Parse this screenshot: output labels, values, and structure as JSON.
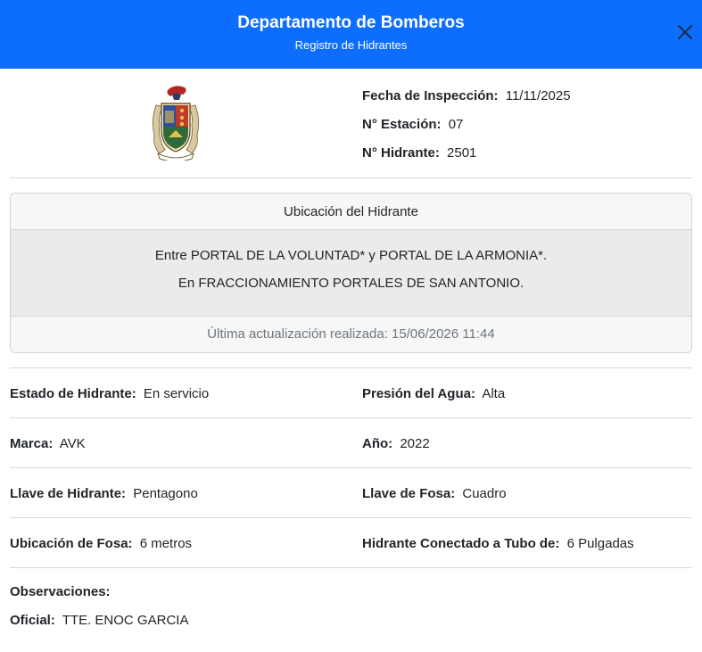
{
  "header": {
    "title": "Departamento de Bomberos",
    "subtitle": "Registro de Hidrantes"
  },
  "icons": {
    "close": "close-icon",
    "emblem": "coat-of-arms-emblem"
  },
  "colors": {
    "header_bg": "#0d6efd",
    "card_body_bg": "#ebebeb",
    "muted_text": "#6c757d"
  },
  "meta": {
    "fecha_label": "Fecha de Inspección:",
    "fecha_value": "11/11/2025",
    "estacion_label": "N° Estación:",
    "estacion_value": "07",
    "hidrante_label": "N° Hidrante:",
    "hidrante_value": "2501"
  },
  "ubicacion": {
    "header": "Ubicación del Hidrante",
    "line1": "Entre PORTAL DE LA VOLUNTAD* y PORTAL DE LA ARMONIA*.",
    "line2": "En FRACCIONAMIENTO PORTALES DE SAN ANTONIO.",
    "footer": "Última actualización realizada: 15/06/2026 11:44"
  },
  "details": [
    {
      "left_label": "Estado de Hidrante:",
      "left_value": "En servicio",
      "right_label": "Presión del Agua:",
      "right_value": "Alta"
    },
    {
      "left_label": "Marca:",
      "left_value": "AVK",
      "right_label": "Año:",
      "right_value": "2022"
    },
    {
      "left_label": "Llave de Hidrante:",
      "left_value": "Pentagono",
      "right_label": "Llave de Fosa:",
      "right_value": "Cuadro"
    },
    {
      "left_label": "Ubicación de Fosa:",
      "left_value": "6 metros",
      "right_label": "Hidrante Conectado a Tubo de:",
      "right_value": "6 Pulgadas"
    }
  ],
  "observaciones": {
    "label": "Observaciones:",
    "oficial_label": "Oficial:",
    "oficial_value": "TTE. ENOC GARCIA"
  }
}
